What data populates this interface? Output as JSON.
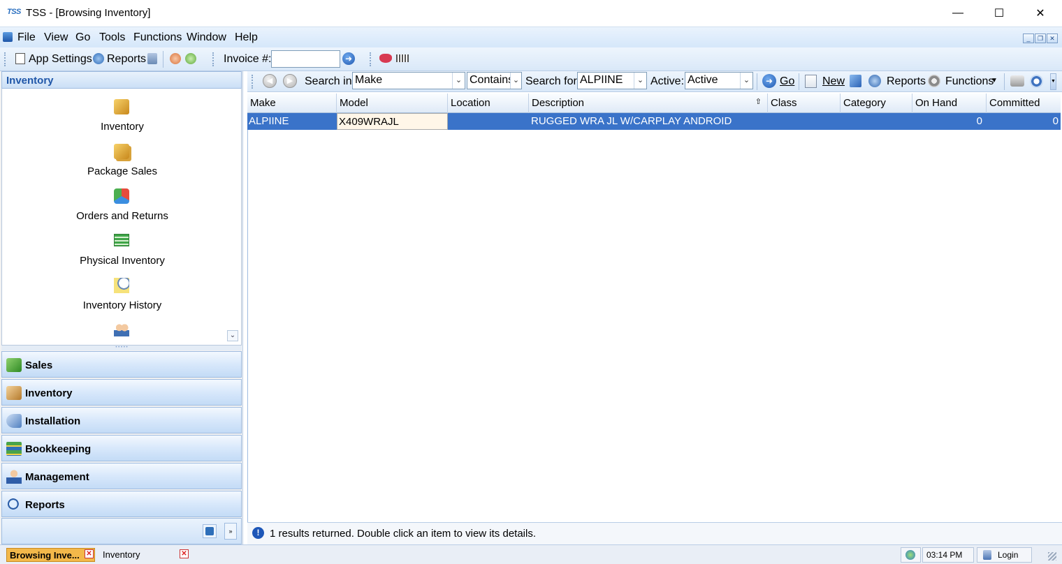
{
  "window": {
    "logo": "TSS",
    "title": "TSS - [Browsing Inventory]",
    "minimize": "—",
    "maximize": "☐",
    "close": "✕"
  },
  "menu": [
    "File",
    "View",
    "Go",
    "Tools",
    "Functions",
    "Window",
    "Help"
  ],
  "toolbar": {
    "app_settings": "App Settings",
    "reports": "Reports",
    "invoice_label": "Invoice #:",
    "invoice_value": ""
  },
  "nav": {
    "header": "Inventory",
    "items": [
      "Inventory",
      "Package Sales",
      "Orders and Returns",
      "Physical Inventory",
      "Inventory History"
    ],
    "groups": [
      "Sales",
      "Inventory",
      "Installation",
      "Bookkeeping",
      "Management",
      "Reports"
    ]
  },
  "search": {
    "search_in_label": "Search in:",
    "search_in_value": "Make",
    "match_value": "Contains",
    "search_for_label": "Search for:",
    "search_for_value": "ALPIINE",
    "active_label": "Active:",
    "active_value": "Active",
    "go": "Go",
    "new": "New",
    "reports": "Reports",
    "functions": "Functions"
  },
  "grid": {
    "columns": [
      "Make",
      "Model",
      "Location",
      "Description",
      "Class",
      "Category",
      "On Hand",
      "Committed"
    ],
    "rows": [
      {
        "make": "ALPIINE",
        "model": "X409WRAJL",
        "location": "",
        "description": "RUGGED WRA JL W/CARPLAY ANDROID",
        "class": "",
        "category": "",
        "on_hand": "0",
        "committed": "0"
      }
    ]
  },
  "status": {
    "message": "1 results returned. Double click an item to view its details."
  },
  "bottom": {
    "tabs": [
      "Browsing Inve...",
      "Inventory"
    ],
    "time": "03:14 PM",
    "login": "Login"
  },
  "colors": {
    "selection": "#3a73c9",
    "accent": "#1f56a8"
  }
}
